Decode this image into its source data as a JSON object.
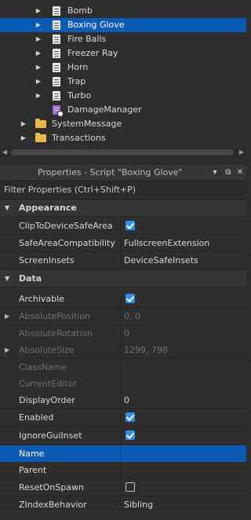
{
  "explorer": {
    "items": [
      {
        "label": "Bomb",
        "icon": "script-icon",
        "expanded": false
      },
      {
        "label": "Boxing Glove",
        "icon": "script-icon",
        "expanded": false,
        "selected": true
      },
      {
        "label": "Fire Balls",
        "icon": "script-icon",
        "expanded": false
      },
      {
        "label": "Freezer Ray",
        "icon": "script-icon",
        "expanded": false
      },
      {
        "label": "Horn",
        "icon": "script-icon",
        "expanded": false
      },
      {
        "label": "Trap",
        "icon": "script-icon",
        "expanded": false
      },
      {
        "label": "Turbo",
        "icon": "script-icon",
        "expanded": false
      },
      {
        "label": "DamageManager",
        "icon": "module-script-icon"
      },
      {
        "label": "SystemMessage",
        "icon": "folder-icon",
        "expanded": false
      },
      {
        "label": "Transactions",
        "icon": "folder-icon",
        "expanded": false
      }
    ]
  },
  "properties": {
    "title": "Properties - Script \"Boxing Glove\"",
    "filter_placeholder": "Filter Properties (Ctrl+Shift+P)",
    "categories": {
      "appearance": {
        "title": "Appearance",
        "rows": {
          "clip": {
            "name": "ClipToDeviceSafeArea",
            "value": true
          },
          "safe_area": {
            "name": "SafeAreaCompatibility",
            "value": "FullscreenExtension"
          },
          "insets": {
            "name": "ScreenInsets",
            "value": "DeviceSafeInsets"
          }
        }
      },
      "data": {
        "title": "Data",
        "rows": {
          "archivable": {
            "name": "Archivable",
            "value": true
          },
          "abs_pos": {
            "name": "AbsolutePosition",
            "value": "0, 0"
          },
          "abs_rot": {
            "name": "AbsoluteRotation",
            "value": "0"
          },
          "abs_size": {
            "name": "AbsoluteSize",
            "value": "1299, 798"
          },
          "class_name": {
            "name": "ClassName",
            "value": ""
          },
          "current_editor": {
            "name": "CurrentEditor",
            "value": ""
          },
          "display_order": {
            "name": "DisplayOrder",
            "value": "0"
          },
          "enabled": {
            "name": "Enabled",
            "value": true
          },
          "ignore_inset": {
            "name": "IgnoreGuiInset",
            "value": true
          },
          "name": {
            "name": "Name",
            "value": ""
          },
          "parent": {
            "name": "Parent",
            "value": ""
          },
          "reset_on_spawn": {
            "name": "ResetOnSpawn",
            "value": false
          },
          "zindex": {
            "name": "ZIndexBehavior",
            "value": "Sibling"
          }
        }
      }
    }
  },
  "colors": {
    "selection": "#0b5bb5",
    "checkbox": "#2f8ee6",
    "folder": "#e8b84a",
    "module": "#9c6bd6"
  }
}
